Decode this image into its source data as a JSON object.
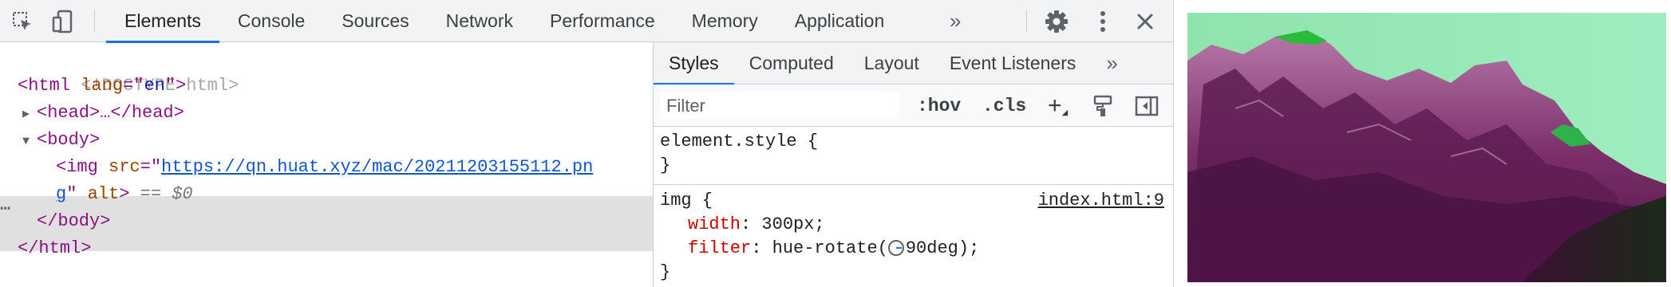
{
  "toolbar": {
    "tabs": [
      "Elements",
      "Console",
      "Sources",
      "Network",
      "Performance",
      "Memory",
      "Application"
    ],
    "more": "»"
  },
  "dom": {
    "doctype": "<!DOCTYPE html>",
    "html_open": {
      "tag": "html",
      "attr": "lang",
      "value": "en"
    },
    "head": "<head>…</head>",
    "body_open": "<body>",
    "img": {
      "tag": "img",
      "src_attr": "src",
      "src_part1": "https://qn.huat.xyz/mac/20211203155112.pn",
      "src_part2": "g",
      "alt_attr": "alt",
      "eq": " == ",
      "ref": "$0"
    },
    "body_close": "</body>",
    "html_close": "</html>"
  },
  "styles": {
    "tabs": [
      "Styles",
      "Computed",
      "Layout",
      "Event Listeners"
    ],
    "more": "»",
    "filter_placeholder": "Filter",
    "hov": ":hov",
    "cls": ".cls",
    "add": "+",
    "element_style": {
      "selector": "element.style",
      "open": " {",
      "close": "}"
    },
    "img_rule": {
      "selector": "img",
      "open": " {",
      "source": "index.html:9",
      "props": [
        {
          "name": "width",
          "value": "300px;"
        },
        {
          "name": "filter",
          "value_prefix": "hue-rotate(",
          "value_num": "90deg",
          "value_suffix": ");"
        }
      ],
      "close": "}"
    }
  }
}
